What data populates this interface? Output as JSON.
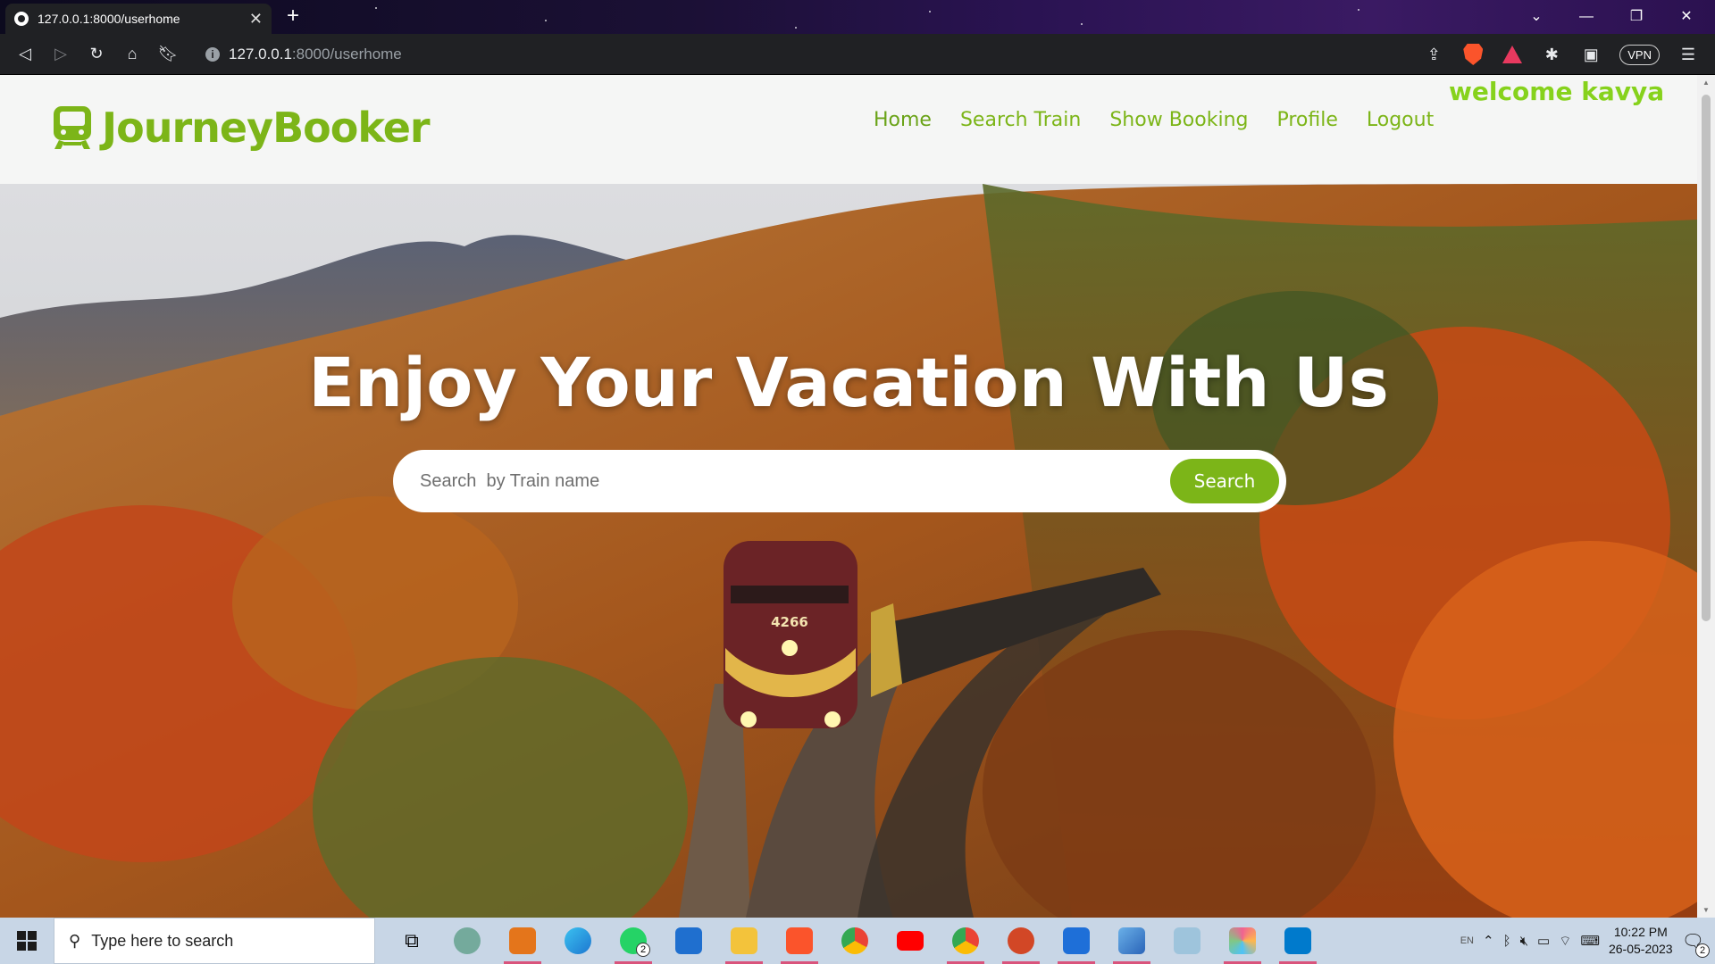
{
  "browser": {
    "tab_title": "127.0.0.1:8000/userhome",
    "new_tab": "+",
    "url_host": "127.0.0.1",
    "url_rest": ":8000/userhome",
    "vpn_label": "VPN"
  },
  "site": {
    "brand": "JourneyBooker",
    "welcome": "welcome kavya",
    "nav": [
      {
        "label": "Home",
        "active": true
      },
      {
        "label": "Search Train",
        "active": false
      },
      {
        "label": "Show Booking",
        "active": false
      },
      {
        "label": "Profile",
        "active": false
      },
      {
        "label": "Logout",
        "active": false
      }
    ],
    "accent_color": "#7cb518"
  },
  "hero": {
    "title": "Enjoy Your Vacation With Us",
    "search_placeholder": "Search  by Train name",
    "search_button": "Search",
    "train_number": "4266"
  },
  "taskbar": {
    "search_placeholder": "Type here to search",
    "whatsapp_badge": "2",
    "lang": "EN",
    "time": "10:22 PM",
    "date": "26-05-2023",
    "notifications": "2"
  }
}
